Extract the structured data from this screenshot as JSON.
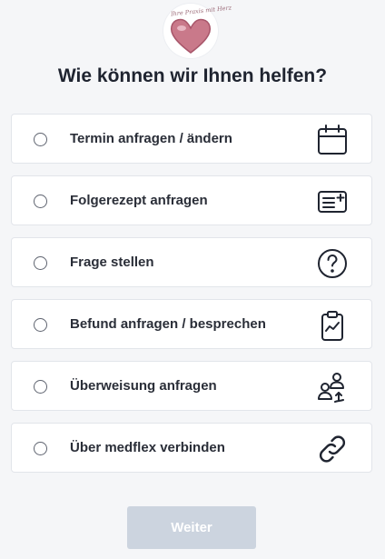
{
  "logo": {
    "text": "Ihre Praxis mit Herz"
  },
  "title": "Wie können wir Ihnen helfen?",
  "options": [
    {
      "label": "Termin anfragen / ändern",
      "icon": "calendar-icon"
    },
    {
      "label": "Folgerezept anfragen",
      "icon": "prescription-add-icon"
    },
    {
      "label": "Frage stellen",
      "icon": "question-icon"
    },
    {
      "label": "Befund anfragen / besprechen",
      "icon": "clipboard-chart-icon"
    },
    {
      "label": "Überweisung anfragen",
      "icon": "referral-users-icon"
    },
    {
      "label": "Über medflex verbinden",
      "icon": "link-icon"
    }
  ],
  "submit": {
    "label": "Weiter",
    "disabled": true
  },
  "colors": {
    "background": "#f5f6f8",
    "text": "#1f2430",
    "button_disabled": "#ccd4df",
    "logo_heart": "#c9798a"
  }
}
